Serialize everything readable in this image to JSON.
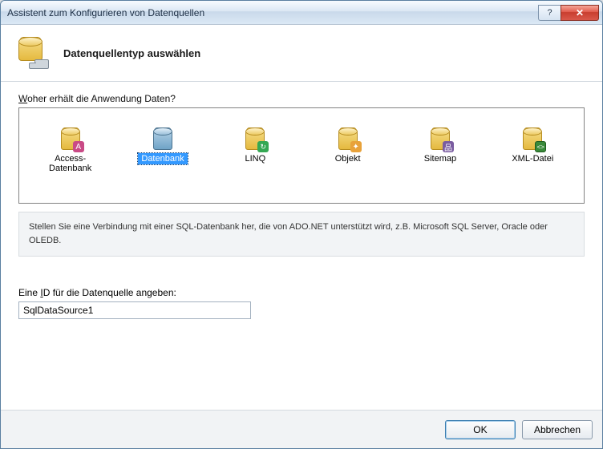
{
  "window": {
    "title": "Assistent zum Konfigurieren von Datenquellen"
  },
  "header": {
    "title": "Datenquellentyp auswählen"
  },
  "sourceSection": {
    "question_prefix_underlined": "W",
    "question_rest": "oher erhält die Anwendung Daten?",
    "items": [
      {
        "label": "Access-Datenbank",
        "icon": "db-yellow",
        "badge": "key"
      },
      {
        "label": "Datenbank",
        "icon": "db-blue",
        "badge": "",
        "selected": true
      },
      {
        "label": "LINQ",
        "icon": "db-yellow",
        "badge": "refresh"
      },
      {
        "label": "Objekt",
        "icon": "db-yellow",
        "badge": "gear"
      },
      {
        "label": "Sitemap",
        "icon": "db-yellow",
        "badge": "tree"
      },
      {
        "label": "XML-Datei",
        "icon": "db-yellow",
        "badge": "xml"
      }
    ],
    "description": "Stellen Sie eine Verbindung mit einer SQL-Datenbank her, die von ADO.NET unterstützt wird, z.B. Microsoft SQL Server, Oracle oder OLEDB."
  },
  "idSection": {
    "label_prefix": "Eine ",
    "label_underlined": "I",
    "label_rest": "D für die Datenquelle angeben:",
    "value": "SqlDataSource1"
  },
  "footer": {
    "ok": "OK",
    "cancel": "Abbrechen"
  }
}
